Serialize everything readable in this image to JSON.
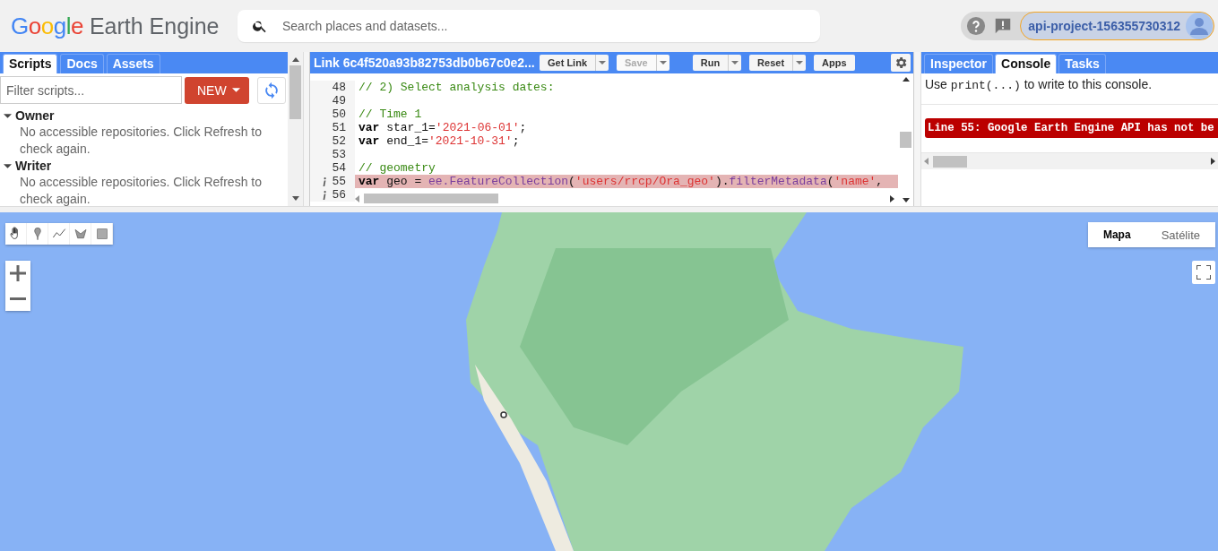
{
  "header": {
    "logo_google": "Google",
    "logo_product": "Earth Engine",
    "search": {
      "placeholder": "Search places and datasets..."
    },
    "project": "api-project-156355730312"
  },
  "scripts_panel": {
    "tabs": [
      {
        "label": "Scripts",
        "selected": true
      },
      {
        "label": "Docs",
        "selected": false
      },
      {
        "label": "Assets",
        "selected": false
      }
    ],
    "filter": {
      "placeholder": "Filter scripts..."
    },
    "new_button": "NEW",
    "groups": [
      {
        "label": "Owner",
        "expanded": true,
        "message": "No accessible repositories. Click Refresh to check again."
      },
      {
        "label": "Writer",
        "expanded": true,
        "message": "No accessible repositories. Click Refresh to check again."
      }
    ]
  },
  "editor": {
    "title": "Link 6c4f520a93b82753db0b67c0e2...",
    "buttons": [
      {
        "label": "Get Link",
        "disabled": false,
        "dropdown": true
      },
      {
        "label": "Save",
        "disabled": true,
        "dropdown": true
      },
      {
        "label": "Run",
        "disabled": false,
        "dropdown": true
      },
      {
        "label": "Reset",
        "disabled": false,
        "dropdown": true
      },
      {
        "label": "Apps",
        "disabled": false,
        "dropdown": false
      }
    ],
    "lines": [
      {
        "number": "48",
        "error": false,
        "info": false,
        "tokens": [
          {
            "kind": "comment",
            "text": "// 2) Select analysis dates:"
          }
        ]
      },
      {
        "number": "49",
        "error": false,
        "info": false
      },
      {
        "number": "50",
        "error": false,
        "info": false,
        "tokens": [
          {
            "kind": "comment",
            "text": "// Time 1"
          }
        ]
      },
      {
        "number": "51",
        "error": false,
        "info": false,
        "tokens": [
          {
            "kind": "keyword",
            "text": "var"
          },
          {
            "kind": "plain",
            "text": " star_1="
          },
          {
            "kind": "string",
            "text": "'2021-06-01'"
          },
          {
            "kind": "plain",
            "text": ";"
          }
        ]
      },
      {
        "number": "52",
        "error": false,
        "info": false,
        "tokens": [
          {
            "kind": "keyword",
            "text": "var"
          },
          {
            "kind": "plain",
            "text": " end_1="
          },
          {
            "kind": "string",
            "text": "'2021-10-31'"
          },
          {
            "kind": "plain",
            "text": ";"
          }
        ]
      },
      {
        "number": "53",
        "error": false,
        "info": false
      },
      {
        "number": "54",
        "error": false,
        "info": false,
        "tokens": [
          {
            "kind": "comment",
            "text": "// geometry"
          }
        ]
      },
      {
        "number": "55",
        "error": true,
        "info": true,
        "tokens": [
          {
            "kind": "keyword",
            "text": "var"
          },
          {
            "kind": "plain",
            "text": " geo = "
          },
          {
            "kind": "method",
            "text": "ee.FeatureCollection"
          },
          {
            "kind": "plain",
            "text": "("
          },
          {
            "kind": "string",
            "text": "'users/rrcp/Ora_geo'"
          },
          {
            "kind": "plain",
            "text": ")."
          },
          {
            "kind": "method",
            "text": "filterMetadata"
          },
          {
            "kind": "plain",
            "text": "("
          },
          {
            "kind": "string",
            "text": "'name'"
          },
          {
            "kind": "plain",
            "text": ","
          }
        ]
      },
      {
        "number": "56",
        "error": false,
        "info": true
      }
    ]
  },
  "console_panel": {
    "tabs": [
      {
        "label": "Inspector",
        "selected": false
      },
      {
        "label": "Console",
        "selected": true
      },
      {
        "label": "Tasks",
        "selected": false
      }
    ],
    "hint": [
      {
        "kind": "text",
        "text": "Use "
      },
      {
        "kind": "code",
        "text": "print(...)"
      },
      {
        "kind": "text",
        "text": " to write to this console."
      }
    ],
    "error": "Line 55: Google Earth Engine API has not be"
  },
  "map": {
    "view_types": [
      {
        "label": "Mapa",
        "selected": true
      },
      {
        "label": "Satélite",
        "selected": false
      }
    ]
  }
}
